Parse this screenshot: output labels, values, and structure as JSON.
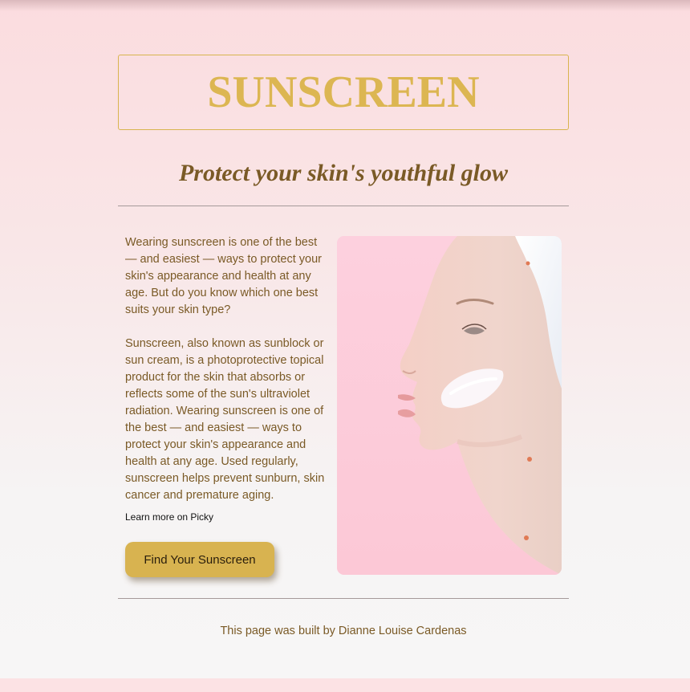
{
  "header": {
    "title": "SUNSCREEN"
  },
  "tagline": "Protect your skin's youthful glow",
  "content": {
    "paragraphs": [
      "Wearing sunscreen is one of the best — and easiest — ways to protect your skin's appearance and health at any age. But do you know which one best suits your skin type?",
      "Sunscreen, also known as sunblock or sun cream, is a photoprotective topical product for the skin that absorbs or reflects some of the sun's ultraviolet radiation. Wearing sunscreen is one of the best — and easiest — ways to protect your skin's appearance and health at any age. Used regularly, sunscreen helps prevent sunburn, skin cancer and premature aging."
    ],
    "link_label": "Learn more on Picky",
    "button_label": "Find Your Sunscreen"
  },
  "footer": {
    "text": "This page was built by Dianne Louise Cardenas"
  },
  "colors": {
    "accent": "#d8b350",
    "text": "#7a5a26",
    "title": "#dcb652"
  }
}
